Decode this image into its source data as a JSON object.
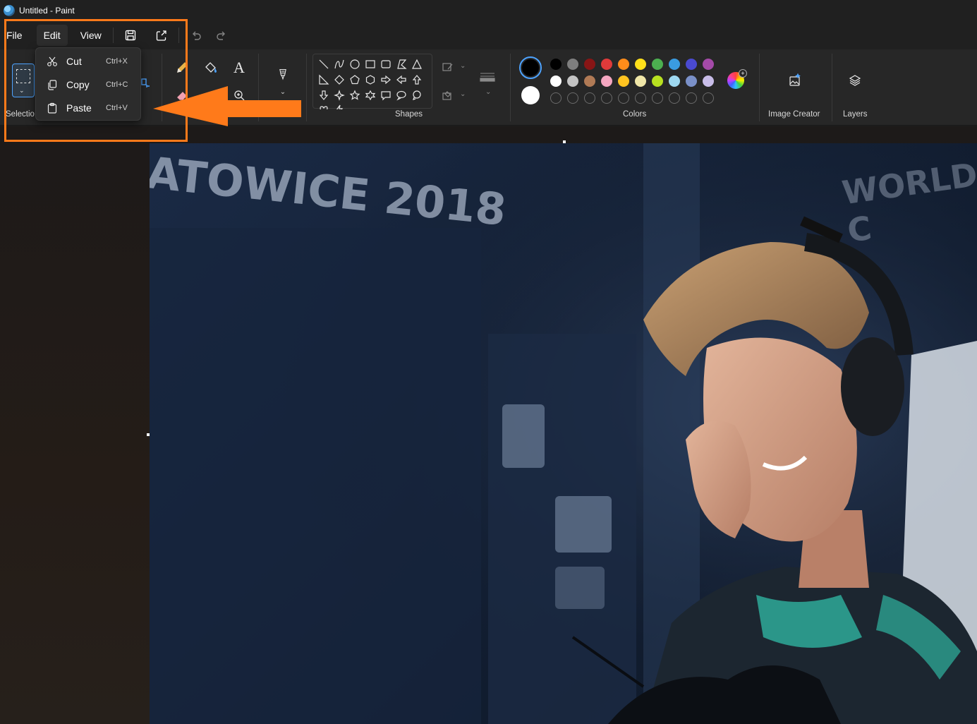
{
  "window": {
    "title": "Untitled - Paint"
  },
  "menubar": {
    "items": [
      {
        "label": "File"
      },
      {
        "label": "Edit"
      },
      {
        "label": "View"
      }
    ]
  },
  "ribbon": {
    "selection_label": "Selectio",
    "shapes_label": "Shapes",
    "colors_label": "Colors",
    "image_creator_label": "Image Creator",
    "layers_label": "Layers",
    "colors": {
      "primary": "#000000",
      "secondary": "#ffffff",
      "palette_row1": [
        "#000000",
        "#7f7f7f",
        "#881515",
        "#e03a3a",
        "#ff8c1a",
        "#ffe01a",
        "#4caf50",
        "#3a9be0",
        "#4a4ad0",
        "#a44aa8"
      ],
      "palette_row2": [
        "#ffffff",
        "#c3c3c3",
        "#b07a55",
        "#f4a6c0",
        "#ffc320",
        "#f0e6a8",
        "#b8e020",
        "#9ed8f0",
        "#7a90c8",
        "#c8bde8"
      ]
    }
  },
  "edit_menu": {
    "items": [
      {
        "label": "Cut",
        "shortcut": "Ctrl+X",
        "icon": "scissors-icon"
      },
      {
        "label": "Copy",
        "shortcut": "Ctrl+C",
        "icon": "copy-icon"
      },
      {
        "label": "Paste",
        "shortcut": "Ctrl+V",
        "icon": "paste-icon"
      }
    ]
  },
  "canvas": {
    "photo_text_1": "ATOWICE 2018",
    "photo_text_2": "WORLD C"
  },
  "annotation": {
    "color": "#ff7a1a"
  }
}
